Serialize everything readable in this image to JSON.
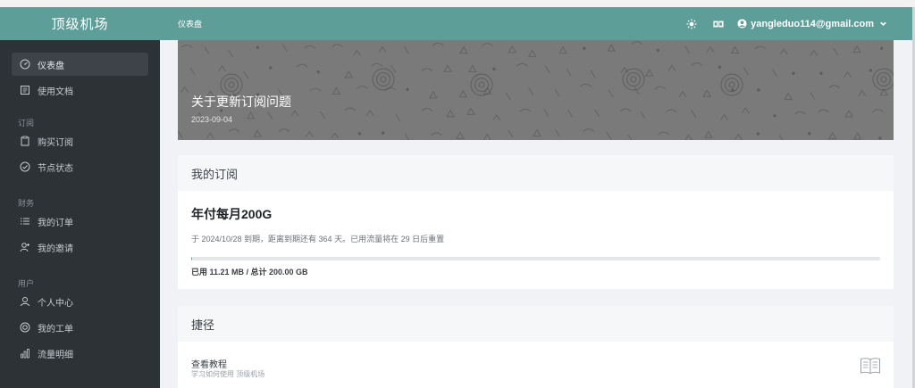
{
  "app": {
    "brand": "顶级机场",
    "accent": "#5e9e99"
  },
  "sidebar": {
    "top_items": [
      {
        "label": "仪表盘",
        "icon": "dashboard-icon",
        "active": true
      },
      {
        "label": "使用文档",
        "icon": "document-icon"
      }
    ],
    "sections": [
      {
        "label": "订阅",
        "items": [
          {
            "label": "购买订阅",
            "icon": "clipboard-icon"
          },
          {
            "label": "节点状态",
            "icon": "check-circle-icon"
          }
        ]
      },
      {
        "label": "财务",
        "items": [
          {
            "label": "我的订单",
            "icon": "list-icon"
          },
          {
            "label": "我的邀请",
            "icon": "user-add-icon"
          }
        ]
      },
      {
        "label": "用户",
        "items": [
          {
            "label": "个人中心",
            "icon": "user-icon"
          },
          {
            "label": "我的工单",
            "icon": "support-icon"
          },
          {
            "label": "流量明细",
            "icon": "bar-chart-icon"
          }
        ]
      }
    ]
  },
  "header": {
    "breadcrumb": "仪表盘",
    "user_email": "yangleduo114@gmail.com",
    "icons": [
      "theme-icon",
      "language-icon",
      "user-circle-icon",
      "chevron-down-icon"
    ]
  },
  "banner": {
    "title": "关于更新订阅问题",
    "date": "2023-09-04"
  },
  "subscription": {
    "heading": "我的订阅",
    "plan": "年付每月200G",
    "description": "于 2024/10/28 到期，距离到期还有 364 天。已用流量将在 29 日后重置",
    "usage": "已用 11.21 MB / 总计 200.00 GB",
    "used_fraction": 0.0001
  },
  "shortcuts": {
    "heading": "捷径",
    "items": [
      {
        "title": "查看教程",
        "desc": "学习如何使用 顶级机场",
        "icon": "book-icon"
      }
    ]
  }
}
